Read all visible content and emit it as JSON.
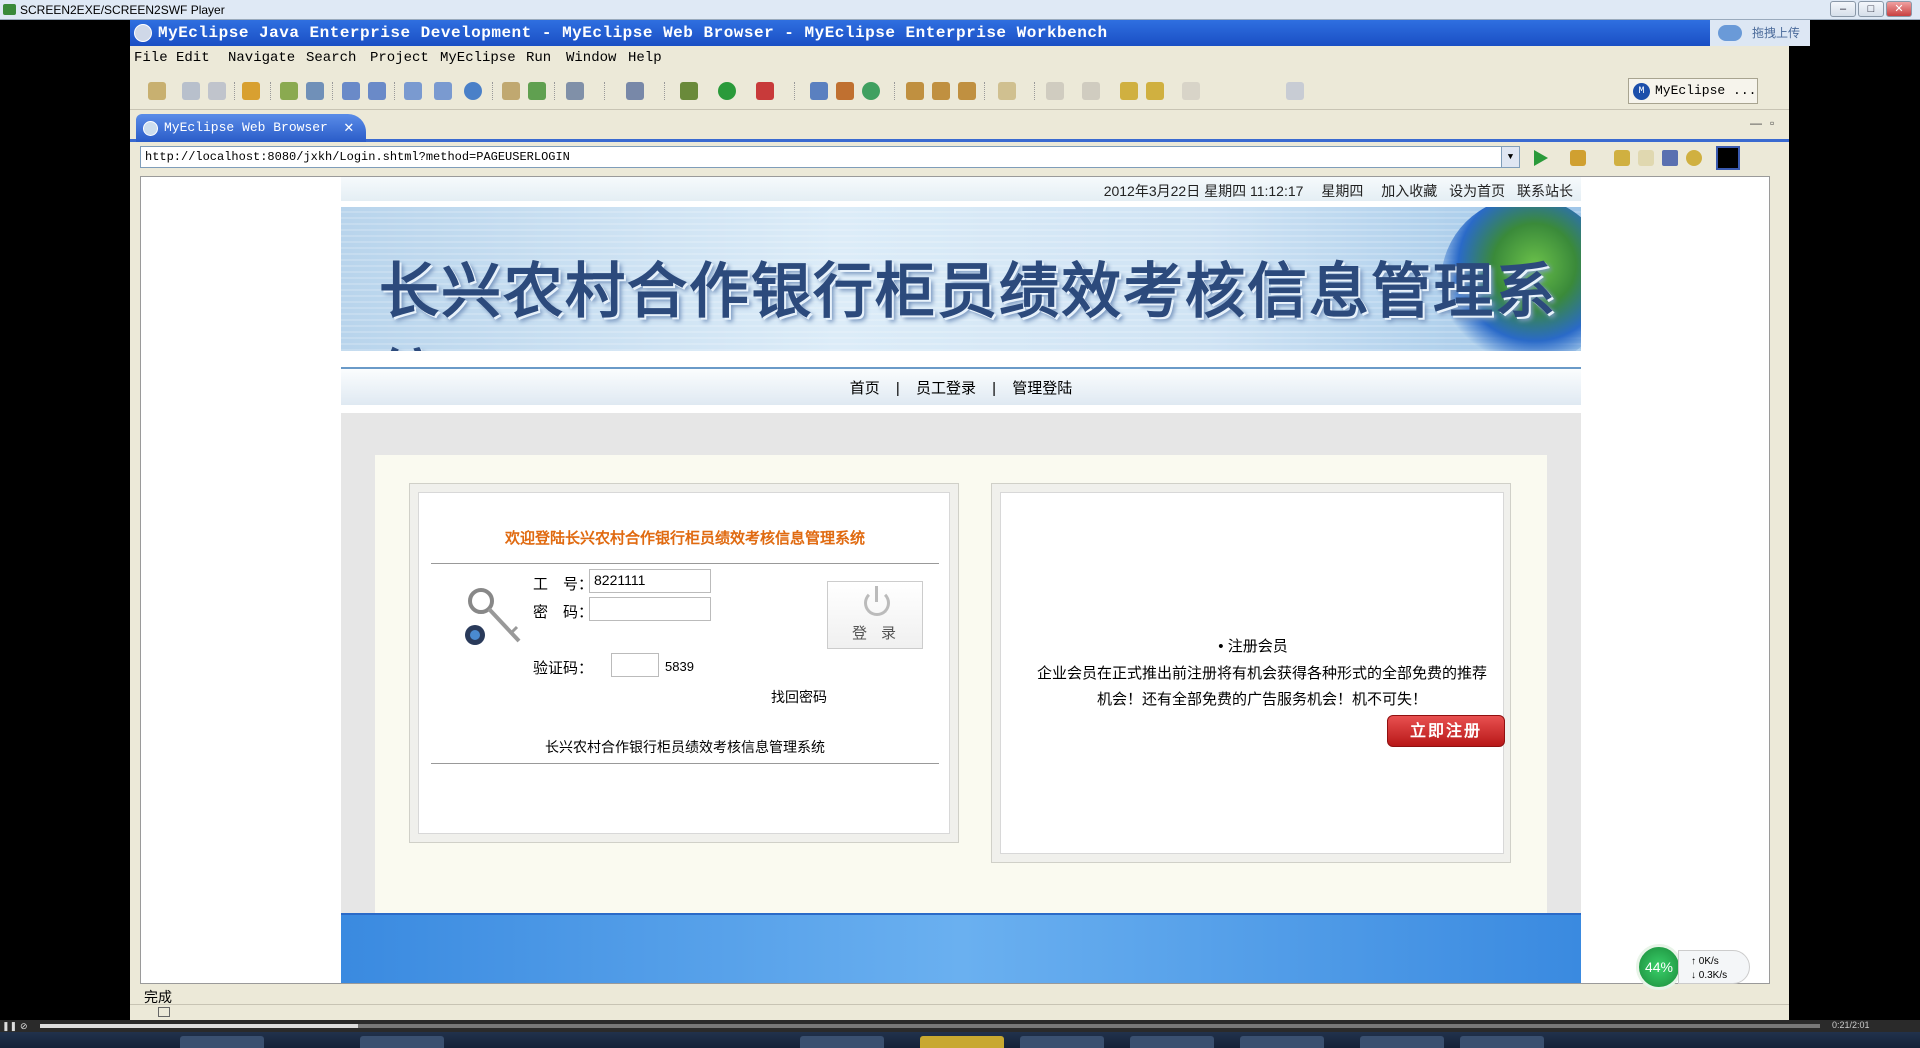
{
  "player": {
    "title": "SCREEN2EXE/SCREEN2SWF Player",
    "time": "0:21/2:01"
  },
  "window": {
    "title": "MyEclipse Java Enterprise Development - MyEclipse Web Browser - MyEclipse Enterprise Workbench",
    "upload_label": "拖拽上传"
  },
  "menubar": [
    "File",
    "Edit",
    "Navigate",
    "Search",
    "Project",
    "MyEclipse",
    "Run",
    "Window",
    "Help"
  ],
  "perspective": "MyEclipse ...",
  "tab": {
    "label": "MyEclipse Web Browser"
  },
  "address": {
    "url": "http://localhost:8080/jxkh/Login.shtml?method=PAGEUSERLOGIN"
  },
  "statusbar": {
    "text": "完成"
  },
  "page": {
    "topinfo": {
      "datetime": "2012年3月22日 星期四 11:12:17",
      "weekday": "星期四",
      "links": [
        "加入收藏",
        "设为首页",
        "联系站长"
      ]
    },
    "banner_title": "长兴农村合作银行柜员绩效考核信息管理系统",
    "nav": [
      "首页",
      "|",
      "员工登录",
      "|",
      "管理登陆"
    ],
    "login": {
      "welcome": "欢迎登陆长兴农村合作银行柜员绩效考核信息管理系统",
      "id_label": "工　号：",
      "id_value": "8221111",
      "pwd_label": "密　码：",
      "captcha_label": "验证码：",
      "captcha_code": "5839",
      "login_button": "登录",
      "forgot": "找回密码",
      "footer": "长兴农村合作银行柜员绩效考核信息管理系统"
    },
    "register": {
      "head": "• 注册会员",
      "text": "企业会员在正式推出前注册将有机会获得各种形式的全部免费的推荐机会！还有全部免费的广告服务机会！机不可失！",
      "button": "立即注册"
    }
  },
  "net": {
    "percent": "44%",
    "up": "0K/s",
    "down": "0.3K/s"
  }
}
